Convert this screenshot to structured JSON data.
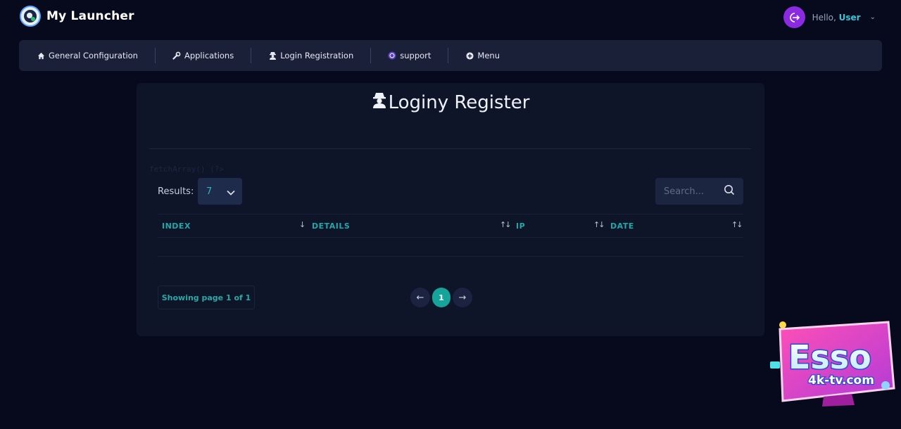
{
  "app": {
    "title": "My Launcher",
    "greeting": "Hello,",
    "username": "User"
  },
  "nav": {
    "items": [
      {
        "label": "General Configuration",
        "icon": "home-icon"
      },
      {
        "label": "Applications",
        "icon": "wrench-icon"
      },
      {
        "label": "Login Registration",
        "icon": "user-secret-icon"
      },
      {
        "label": "support",
        "icon": "whatsapp-icon"
      },
      {
        "label": "Menu",
        "icon": "plus-circle-icon"
      }
    ]
  },
  "page": {
    "title": "Loginy Register",
    "debug_text": "fetchArray() (?>",
    "results_label": "Results:",
    "results_value": "7",
    "search_placeholder": "Search...",
    "columns": [
      {
        "label": "INDEX",
        "sort": "↓"
      },
      {
        "label": "DETAILS",
        "sort": "↑↓"
      },
      {
        "label": "IP",
        "sort": "↑↓"
      },
      {
        "label": "DATE",
        "sort": "↑↓"
      }
    ],
    "rows": [],
    "pagination": {
      "info": "Showing page 1 of 1",
      "current_page": "1",
      "prev": "←",
      "next": "→"
    }
  },
  "watermark": {
    "brand": "Esso",
    "site": "4k-tv.com"
  },
  "colors": {
    "background": "#070a1c",
    "nav_bg": "#1b2039",
    "card_bg": "#0e1528",
    "accent_teal": "#1fa8a8",
    "logout_purple": "#8a2be2"
  }
}
